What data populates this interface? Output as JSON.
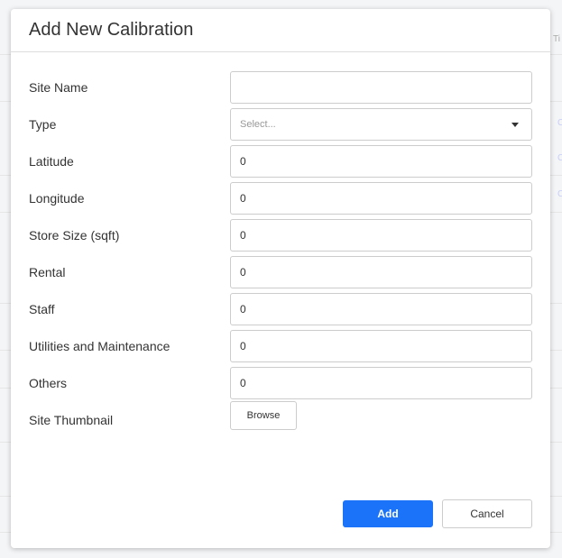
{
  "background": {
    "column_header_fragment": "Ti",
    "link_fragment": "C"
  },
  "modal": {
    "title": "Add New Calibration",
    "fields": {
      "site_name": {
        "label": "Site Name",
        "value": ""
      },
      "type": {
        "label": "Type",
        "placeholder": "Select..."
      },
      "latitude": {
        "label": "Latitude",
        "value": "0"
      },
      "longitude": {
        "label": "Longitude",
        "value": "0"
      },
      "store_size": {
        "label": "Store Size (sqft)",
        "value": "0"
      },
      "rental": {
        "label": "Rental",
        "value": "0"
      },
      "staff": {
        "label": "Staff",
        "value": "0"
      },
      "utilities": {
        "label": "Utilities and Maintenance",
        "value": "0"
      },
      "others": {
        "label": "Others",
        "value": "0"
      },
      "thumbnail": {
        "label": "Site Thumbnail",
        "browse_label": "Browse"
      }
    },
    "buttons": {
      "add_label": "Add",
      "cancel_label": "Cancel"
    }
  },
  "colors": {
    "primary": "#1a73f8",
    "border": "#cccccc"
  }
}
